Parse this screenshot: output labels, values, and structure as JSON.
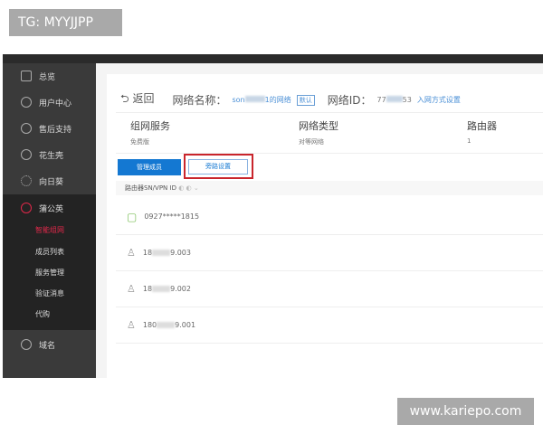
{
  "overlay": {
    "tag": "TG: MYYJJPP",
    "watermark": "www.kariepo.com"
  },
  "sidebar": {
    "items": [
      {
        "label": "总览",
        "icon": "grid-icon"
      },
      {
        "label": "用户中心",
        "icon": "user-icon"
      },
      {
        "label": "售后支持",
        "icon": "headset-icon"
      },
      {
        "label": "花生壳",
        "icon": "peanut-icon"
      },
      {
        "label": "向日葵",
        "icon": "sunflower-icon"
      },
      {
        "label": "蒲公英",
        "icon": "dandelion-icon"
      },
      {
        "label": "域名",
        "icon": "domain-icon"
      }
    ],
    "subitems": [
      "智能组网",
      "成员列表",
      "服务管理",
      "验证消息",
      "代购"
    ],
    "active_sub": "智能组网"
  },
  "header": {
    "back": "返回",
    "name_label": "网络名称：",
    "name_prefix": "son",
    "name_suffix": "1的网络",
    "default_badge": "默认",
    "id_label": "网络ID：",
    "id_prefix": "77",
    "id_suffix": "53",
    "join_link": "入网方式设置"
  },
  "info": [
    {
      "title": "组网服务",
      "value": "免费版"
    },
    {
      "title": "网络类型",
      "value": "对等网络"
    },
    {
      "title": "路由器",
      "value": "1"
    }
  ],
  "tabs": {
    "manage": "管理成员",
    "bypass": "旁路设置"
  },
  "list": {
    "header": "路由器SN/VPN ID",
    "rows": [
      {
        "type": "router",
        "prefix": "0927*****1815",
        "suffix": ""
      },
      {
        "type": "user",
        "prefix": "18",
        "suffix": "9.003"
      },
      {
        "type": "user",
        "prefix": "18",
        "suffix": "9.002"
      },
      {
        "type": "user",
        "prefix": "180",
        "suffix": "9.001"
      }
    ]
  },
  "colors": {
    "accent": "#1478d2",
    "highlight": "#c9252c",
    "active": "#e0284a"
  }
}
